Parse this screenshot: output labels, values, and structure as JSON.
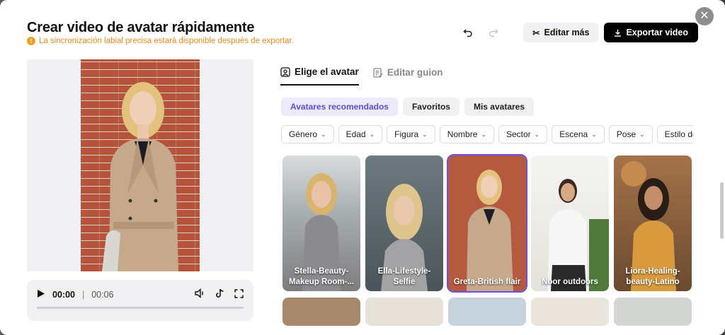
{
  "header": {
    "title": "Crear video de avatar rápidamente",
    "warning": "La sincronización labial precisa estará disponible después de exportar."
  },
  "toolbar": {
    "edit_more": "Editar más",
    "export": "Exportar video"
  },
  "player": {
    "current_time": "00:00",
    "separator": "|",
    "total_time": "00:06",
    "progress": 0
  },
  "tabs": [
    {
      "label": "Elige el avatar",
      "active": true
    },
    {
      "label": "Editar guion",
      "active": false
    }
  ],
  "chips": [
    {
      "label": "Avatares recomendados",
      "active": true
    },
    {
      "label": "Favoritos",
      "active": false
    },
    {
      "label": "Mis avatares",
      "active": false
    }
  ],
  "filters": [
    "Género",
    "Edad",
    "Figura",
    "Nombre",
    "Sector",
    "Escena",
    "Pose",
    "Estilo del atu"
  ],
  "avatars": [
    {
      "name": "Stella-Beauty-Makeup Room-...",
      "selected": false
    },
    {
      "name": "Ella-Lifestyle-Selfie",
      "selected": false
    },
    {
      "name": "Greta-British flair",
      "selected": true
    },
    {
      "name": "Noor outdoors",
      "selected": false
    },
    {
      "name": "Liora-Healing-beauty-Latino",
      "selected": false
    }
  ],
  "colors": {
    "accent": "#6a4fe8",
    "warning": "#e88a1a",
    "primary_button": "#000000"
  }
}
